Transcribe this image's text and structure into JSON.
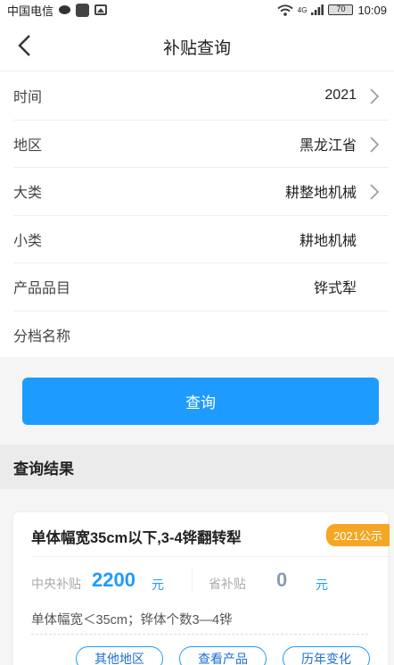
{
  "statusbar": {
    "carrier": "中国电信",
    "network": "4G",
    "battery": "70",
    "time": "10:09"
  },
  "header": {
    "title": "补贴查询"
  },
  "form": {
    "rows": [
      {
        "label": "时间",
        "value": "2021",
        "has_arrow": true
      },
      {
        "label": "地区",
        "value": "黑龙江省",
        "has_arrow": true
      },
      {
        "label": "大类",
        "value": "耕整地机械",
        "has_arrow": true
      },
      {
        "label": "小类",
        "value": "耕地机械",
        "has_arrow": false
      },
      {
        "label": "产品品目",
        "value": "铧式犁",
        "has_arrow": false
      },
      {
        "label": "分档名称",
        "value": "",
        "has_arrow": false
      }
    ]
  },
  "query_button": "查询",
  "result": {
    "header": "查询结果",
    "card": {
      "title": "单体幅宽35cm以下,3-4铧翻转犁",
      "badge": "2021公示",
      "central_label": "中央补贴",
      "central_value": "2200",
      "central_unit": "元",
      "province_label": "省补贴",
      "province_value": "0",
      "province_unit": "元",
      "description": "单体幅宽＜35cm；铧体个数3—4铧",
      "actions": [
        "其他地区",
        "查看产品",
        "历年变化"
      ]
    }
  },
  "colors": {
    "accent": "#1e9bff",
    "badge": "#f5a623",
    "province_value": "#8a9bb5"
  }
}
